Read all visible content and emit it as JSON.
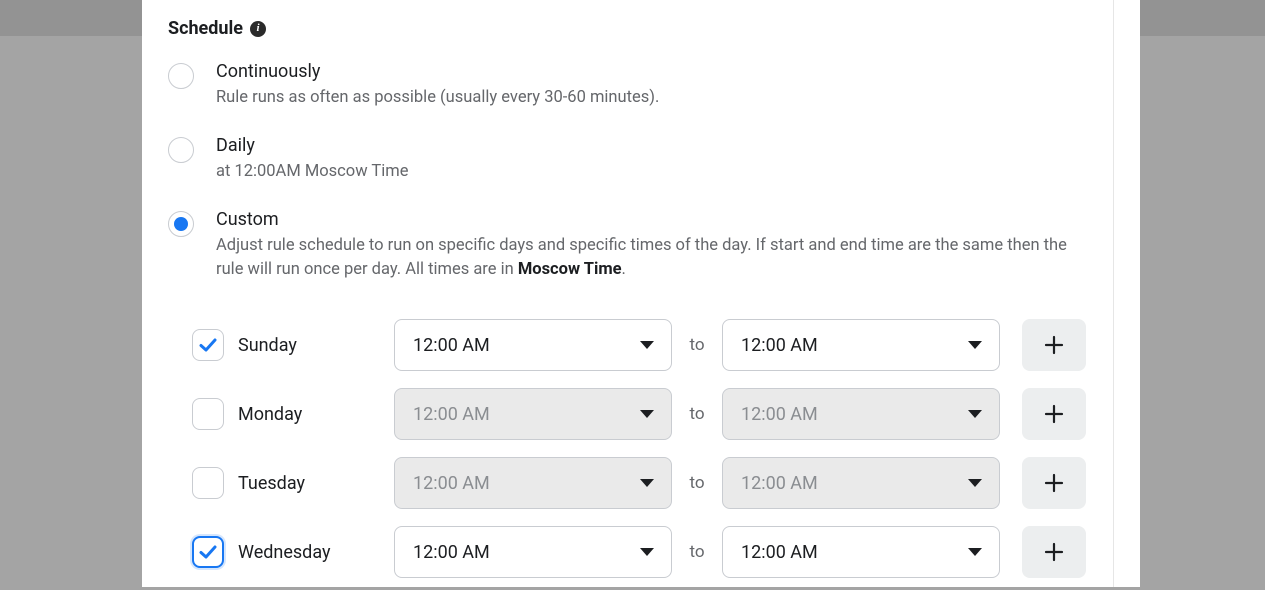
{
  "section": {
    "title": "Schedule"
  },
  "options": {
    "continuous": {
      "label": "Continuously",
      "sub": "Rule runs as often as possible (usually every 30-60 minutes).",
      "selected": false
    },
    "daily": {
      "label": "Daily",
      "sub": "at 12:00AM Moscow Time",
      "selected": false
    },
    "custom": {
      "label": "Custom",
      "sub_prefix": "Adjust rule schedule to run on specific days and specific times of the day. If start and end time are the same then the rule will run once per day. All times are in ",
      "tz": "Moscow Time",
      "sub_suffix": ".",
      "selected": true
    }
  },
  "schedule": {
    "to_label": "to",
    "days": [
      {
        "name": "Sunday",
        "checked": true,
        "focused": false,
        "start": "12:00 AM",
        "end": "12:00 AM"
      },
      {
        "name": "Monday",
        "checked": false,
        "focused": false,
        "start": "12:00 AM",
        "end": "12:00 AM"
      },
      {
        "name": "Tuesday",
        "checked": false,
        "focused": false,
        "start": "12:00 AM",
        "end": "12:00 AM"
      },
      {
        "name": "Wednesday",
        "checked": true,
        "focused": true,
        "start": "12:00 AM",
        "end": "12:00 AM"
      }
    ]
  }
}
